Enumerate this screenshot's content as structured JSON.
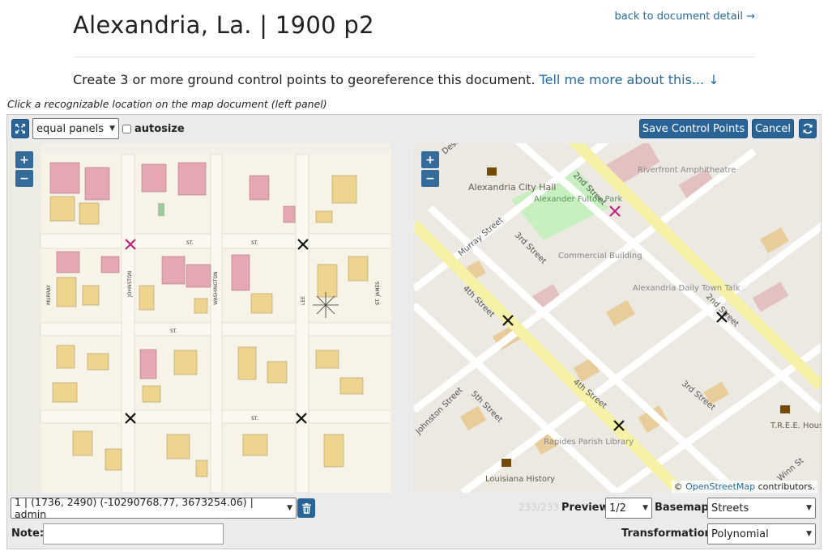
{
  "header": {
    "title": "Alexandria, La. | 1900 p2",
    "back_link": "back to document detail →"
  },
  "instructions": {
    "text": "Create 3 or more ground control points to georeference this document.",
    "more_link": "Tell me more about this... ↓"
  },
  "hint": "Click a recognizable location on the map document (left panel)",
  "toolbar": {
    "panels_select": "equal panels",
    "autosize_label": "autosize",
    "autosize_checked": false,
    "save_label": "Save Control Points",
    "cancel_label": "Cancel"
  },
  "left_map": {
    "zoom_in": "+",
    "zoom_out": "−",
    "streets": [
      "ST.",
      "ST.",
      "ST.",
      "ST."
    ],
    "street_names": [
      "MURRAY",
      "JOHNSTON",
      "WASHINGTON",
      "LEE",
      "ST. JAMES"
    ]
  },
  "right_map": {
    "zoom_in": "+",
    "zoom_out": "−",
    "labels": {
      "city_hall": "Alexandria City Hall",
      "alexander_fulton_park": "Alexander Fulton Park",
      "commercial_building": "Commercial Building",
      "riverfront": "Riverfront Amphitheatre",
      "daily_town_talk": "Alexandria Daily Town Talk",
      "tree_house": "T.R.E.E. House",
      "rapides_library": "Rapides Parish Library",
      "louisiana_history": "Louisiana History",
      "murray_street": "Murray Street",
      "fourth_street": "4th Street",
      "fourth_street_b": "4th Street",
      "third_street": "3rd Street",
      "third_street_b": "3rd Street",
      "second_street": "2nd Street",
      "second_street_b": "2nd Street",
      "fifth_street": "5th Street",
      "johnston_street": "Johnston Street",
      "winn_street": "Winn St",
      "desoto": "Deso"
    },
    "attribution_prefix": "©",
    "attribution_link": "OpenStreetMap",
    "attribution_suffix": "contributors."
  },
  "footer": {
    "gcp_select": "1 | (1736, 2490) (-10290768.77, 3673254.06) | admin",
    "counter": "233/233",
    "preview_label": "Preview",
    "preview_value": "1/2",
    "basemap_label": "Basemap",
    "basemap_value": "Streets",
    "note_label": "Note:",
    "note_value": "",
    "transformation_label": "Transformation:",
    "transformation_value": "Polynomial"
  },
  "colors": {
    "accent": "#2a6496",
    "link": "#2a6a9b",
    "selected_point": "#c2247e",
    "point": "#111111"
  }
}
